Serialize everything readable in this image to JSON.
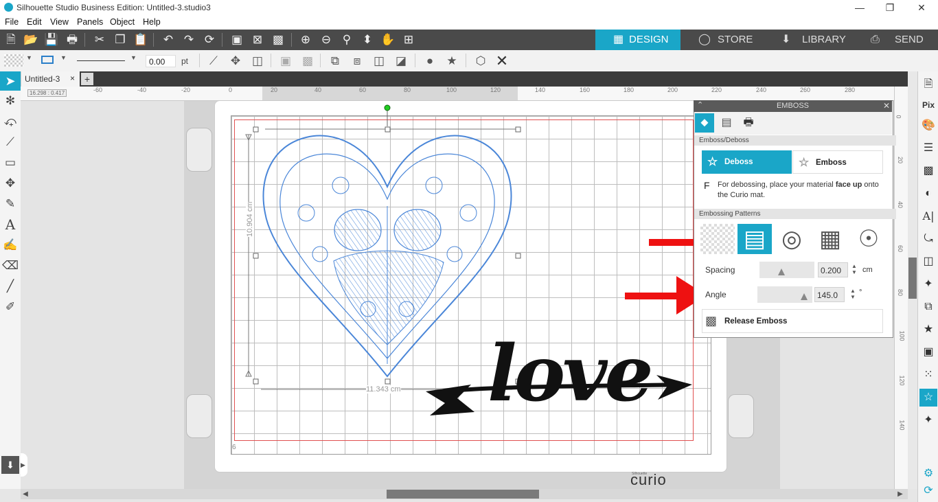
{
  "window": {
    "title": "Silhouette Studio Business Edition: Untitled-3.studio3",
    "controls": [
      "—",
      "❐",
      "✕"
    ]
  },
  "menu": {
    "items": [
      "File",
      "Edit",
      "View",
      "Panels",
      "Object",
      "Help"
    ]
  },
  "nav_tabs": {
    "design": "DESIGN",
    "store": "STORE",
    "library": "LIBRARY",
    "send": "SEND"
  },
  "toolbar2": {
    "line_width_value": "0.00",
    "line_width_unit": "pt"
  },
  "document": {
    "tab_label": "Untitled-3",
    "close": "×",
    "add": "+"
  },
  "ruler": {
    "h_ticks": [
      "-60",
      "-40",
      "-20",
      "0",
      "20",
      "40",
      "60",
      "80",
      "100",
      "120",
      "140",
      "160",
      "180",
      "200",
      "220",
      "240",
      "260",
      "280"
    ],
    "v_ticks": [
      "0",
      "20",
      "40",
      "60",
      "80",
      "100",
      "120",
      "140"
    ],
    "coord_readout": "16.298 : 0.417"
  },
  "canvas": {
    "height_dimension": "10.904 cm",
    "width_dimension": "11.343 cm",
    "mat_number": "6",
    "machine_brand_small": "Silhouette",
    "machine_brand": "curio",
    "design_text": "love"
  },
  "emboss_panel": {
    "title": "EMBOSS",
    "section_mode": "Emboss/Deboss",
    "deboss_label": "Deboss",
    "emboss_label": "Emboss",
    "description_icon": "F",
    "description_pre": "For debossing, place your material ",
    "description_bold": "face up",
    "description_post": " onto the Curio mat.",
    "section_patterns": "Embossing Patterns",
    "spacing_label": "Spacing",
    "spacing_value": "0.200",
    "spacing_unit": "cm",
    "spacing_level": 0.4,
    "angle_label": "Angle",
    "angle_value": "145.0",
    "angle_unit": "°",
    "angle_level": 0.85,
    "release_label": "Release Emboss",
    "selected_pattern": "lines"
  },
  "colors": {
    "accent": "#1aa6c8",
    "toolbar_dark": "#4a4a4a",
    "design_stroke": "#4a86d8",
    "annotation_arrow": "#ee1111"
  }
}
